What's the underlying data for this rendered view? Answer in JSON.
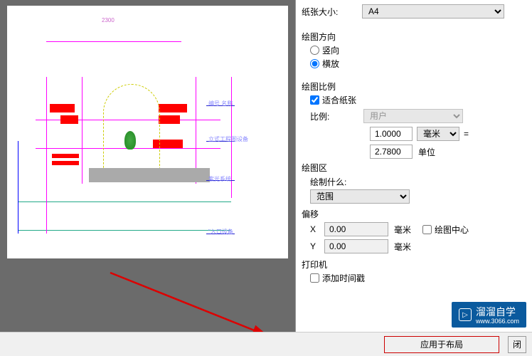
{
  "paper": {
    "size_label": "纸张大小:",
    "size_value": "A4"
  },
  "orientation": {
    "section": "绘图方向",
    "portrait": "竖向",
    "landscape": "横放",
    "selected": "landscape"
  },
  "scale": {
    "section": "绘图比例",
    "fit_paper": "适合纸张",
    "ratio_label": "比例:",
    "ratio_value": "用户",
    "value1": "1.0000",
    "unit1": "毫米",
    "equals": "=",
    "value2": "2.7800",
    "unit2": "单位"
  },
  "area": {
    "section": "绘图区",
    "what_label": "绘制什么:",
    "what_value": "范围"
  },
  "offset": {
    "section": "偏移",
    "x_label": "X",
    "x_value": "0.00",
    "y_label": "Y",
    "y_value": "0.00",
    "unit": "毫米",
    "center": "绘图中心"
  },
  "printer": {
    "section": "打印机",
    "timestamp": "添加时间戳"
  },
  "buttons": {
    "apply": "应用于布局",
    "close": "闭"
  },
  "watermark": {
    "brand": "溜溜自学",
    "url": "www.3066.com"
  },
  "cad_labels": {
    "l1": "编号 名称",
    "l2": "立式工程图设备",
    "l3": "紫光系统",
    "l4": "\"入口设备"
  }
}
